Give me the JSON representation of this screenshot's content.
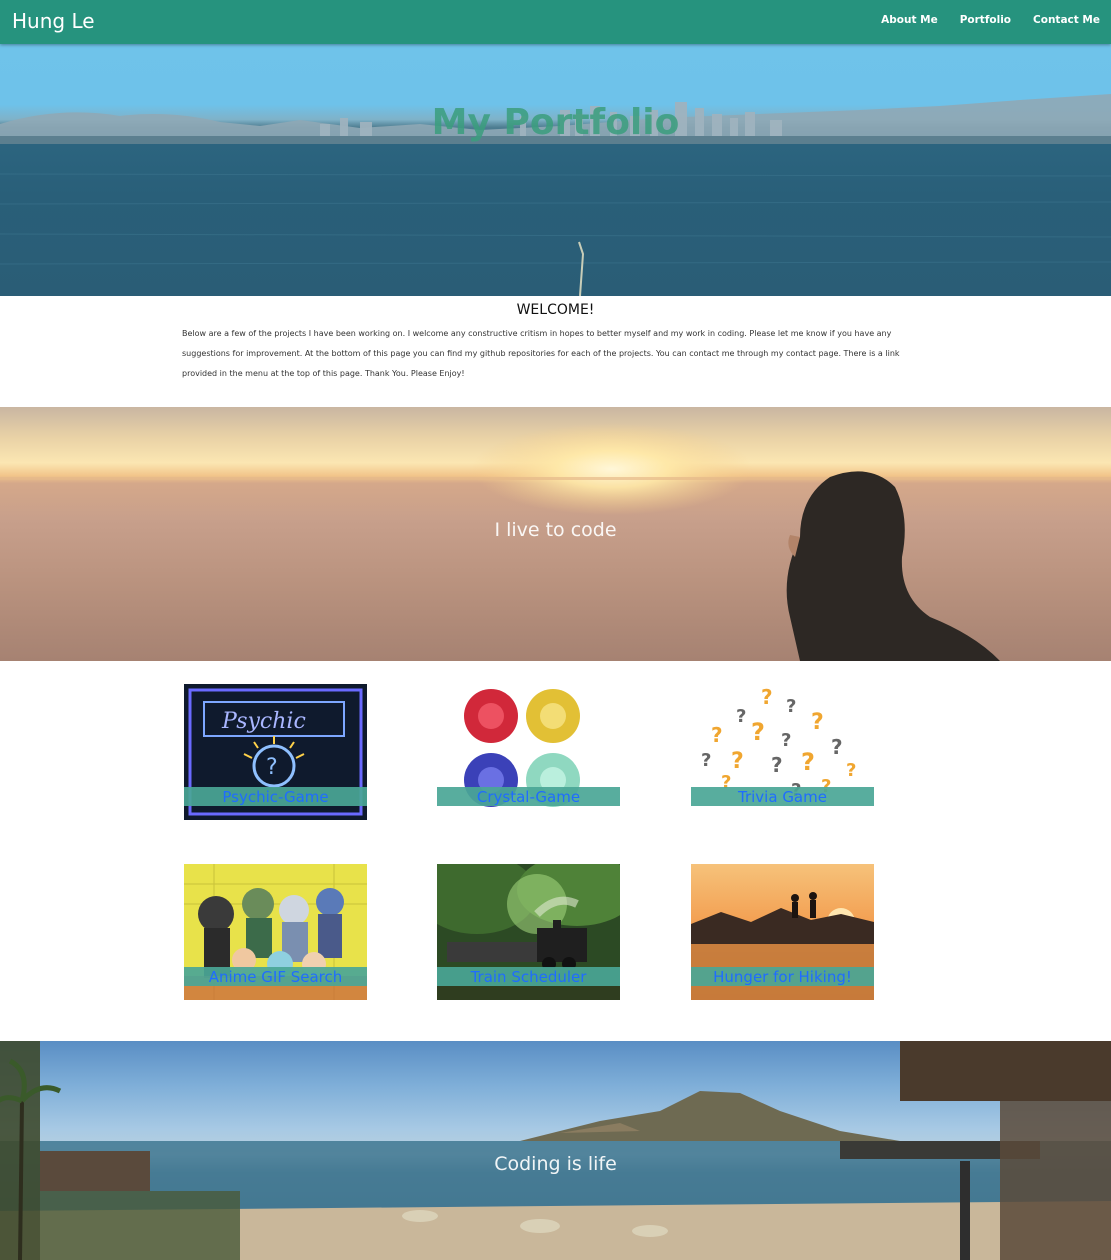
{
  "navbar": {
    "brand": "Hung Le",
    "links": [
      {
        "label": "About Me"
      },
      {
        "label": "Portfolio"
      },
      {
        "label": "Contact Me"
      }
    ],
    "color": "#26937e"
  },
  "hero": {
    "title": "My Portfolio"
  },
  "welcome": {
    "heading": "WELCOME!",
    "text": "Below are a few of the projects I have been working on. I welcome any constructive critism in hopes to better myself and my work in coding. Please let me know if you have any suggestions for improvement. At the bottom of this page you can find my github repositories for each of the projects. You can contact me through my contact page. There is a link provided in the menu at the top of this page. Thank You. Please Enjoy!"
  },
  "sunset": {
    "caption": "I live to code"
  },
  "projects": [
    {
      "title": "Psychic-Game",
      "icon": "psychic-image"
    },
    {
      "title": "Crystal-Game",
      "icon": "crystals-image"
    },
    {
      "title": "Trivia Game",
      "icon": "question-marks-image"
    },
    {
      "title": "Anime GIF Search",
      "icon": "anime-image"
    },
    {
      "title": "Train Scheduler",
      "icon": "train-image"
    },
    {
      "title": "Hunger for Hiking!",
      "icon": "hikers-image"
    }
  ],
  "bottom": {
    "caption": "Coding is life"
  },
  "colors": {
    "caption_bar": "#4aa696",
    "caption_text": "#1f6cff",
    "hero_title": "#3b9e7e"
  }
}
